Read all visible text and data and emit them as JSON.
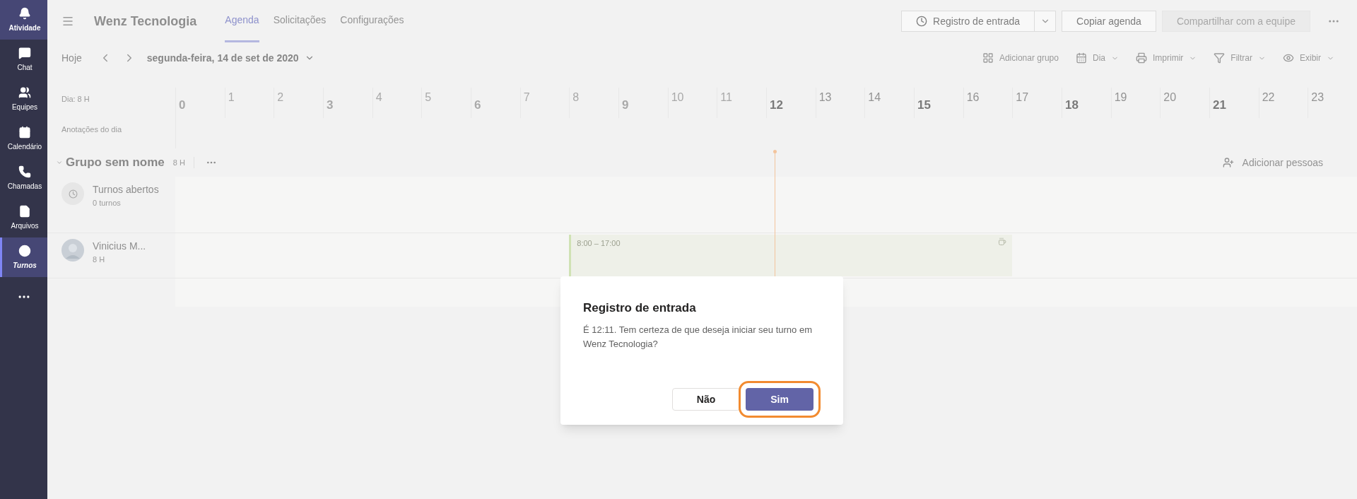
{
  "sidebar": {
    "items": [
      {
        "label": "Atividade",
        "highlighted": true,
        "selected": false
      },
      {
        "label": "Chat",
        "highlighted": false,
        "selected": false
      },
      {
        "label": "Equipes",
        "highlighted": false,
        "selected": false
      },
      {
        "label": "Calendário",
        "highlighted": false,
        "selected": false
      },
      {
        "label": "Chamadas",
        "highlighted": false,
        "selected": false
      },
      {
        "label": "Arquivos",
        "highlighted": false,
        "selected": false
      },
      {
        "label": "Turnos",
        "highlighted": false,
        "selected": true
      }
    ]
  },
  "header": {
    "title": "Wenz Tecnologia",
    "tabs": [
      {
        "label": "Agenda",
        "selected": true
      },
      {
        "label": "Solicitações",
        "selected": false
      },
      {
        "label": "Configurações",
        "selected": false
      }
    ],
    "buttons": [
      {
        "label": "Registro de entrada",
        "kind": "split",
        "disabled": false
      },
      {
        "label": "Copiar agenda",
        "kind": "plain",
        "disabled": false
      },
      {
        "label": "Compartilhar com a equipe",
        "kind": "plain",
        "disabled": true
      }
    ]
  },
  "toolbar": {
    "today": "Hoje",
    "date": "segunda-feira, 14 de set de 2020",
    "actions": [
      {
        "label": "Adicionar grupo",
        "dropdown": false
      },
      {
        "label": "Dia",
        "dropdown": true
      },
      {
        "label": "Imprimir",
        "dropdown": true
      },
      {
        "label": "Filtrar",
        "dropdown": true
      },
      {
        "label": "Exibir",
        "dropdown": true
      }
    ]
  },
  "timeline": {
    "day_total": "Dia: 8 H",
    "notes_label": "Anotações do dia",
    "hours": [
      {
        "label": "0",
        "major": true,
        "past": true
      },
      {
        "label": "1",
        "major": false,
        "past": true
      },
      {
        "label": "2",
        "major": false,
        "past": true
      },
      {
        "label": "3",
        "major": true,
        "past": true
      },
      {
        "label": "4",
        "major": false,
        "past": true
      },
      {
        "label": "5",
        "major": false,
        "past": true
      },
      {
        "label": "6",
        "major": true,
        "past": true
      },
      {
        "label": "7",
        "major": false,
        "past": true
      },
      {
        "label": "8",
        "major": false,
        "past": true
      },
      {
        "label": "9",
        "major": true,
        "past": true
      },
      {
        "label": "10",
        "major": false,
        "past": true
      },
      {
        "label": "11",
        "major": false,
        "past": true
      },
      {
        "label": "12",
        "major": true,
        "past": false
      },
      {
        "label": "13",
        "major": false,
        "past": false
      },
      {
        "label": "14",
        "major": false,
        "past": false
      },
      {
        "label": "15",
        "major": true,
        "past": false
      },
      {
        "label": "16",
        "major": false,
        "past": false
      },
      {
        "label": "17",
        "major": false,
        "past": false
      },
      {
        "label": "18",
        "major": true,
        "past": false
      },
      {
        "label": "19",
        "major": false,
        "past": false
      },
      {
        "label": "20",
        "major": false,
        "past": false
      },
      {
        "label": "21",
        "major": true,
        "past": false
      },
      {
        "label": "22",
        "major": false,
        "past": false
      },
      {
        "label": "23",
        "major": false,
        "past": false
      }
    ]
  },
  "group": {
    "name": "Grupo sem nome",
    "hours": "8 H",
    "add_people": "Adicionar pessoas",
    "rows": [
      {
        "kind": "open",
        "name": "Turnos abertos",
        "detail": "0 turnos"
      },
      {
        "kind": "person",
        "name": "Vinicius M...",
        "detail": "8 H",
        "shift": "8:00 – 17:00"
      }
    ]
  },
  "dialog": {
    "title": "Registro de entrada",
    "message": "É 12:11. Tem certeza de que deseja iniciar seu turno em Wenz Tecnologia?",
    "buttons": [
      {
        "label": "Não",
        "primary": false
      },
      {
        "label": "Sim",
        "primary": true
      }
    ]
  }
}
